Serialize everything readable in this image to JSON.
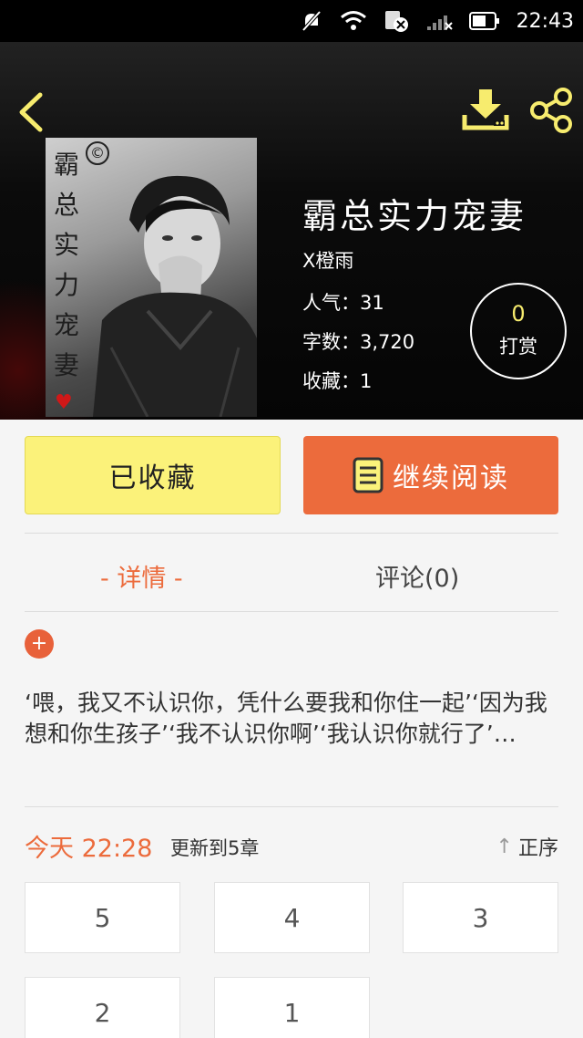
{
  "status_bar": {
    "time": "22:43",
    "icons": [
      "mute-icon",
      "wifi-icon",
      "notification-icon",
      "signal-icon",
      "battery-icon"
    ]
  },
  "header": {
    "back_icon": "chevron-left-icon",
    "download_icon": "download-icon",
    "share_icon": "share-icon",
    "cover": {
      "vertical_title": [
        "霸",
        "总",
        "实",
        "力",
        "宠",
        "妻"
      ]
    },
    "book": {
      "title": "霸总实力宠妻",
      "author": "X橙雨",
      "popularity": "人气：31",
      "word_count": "字数：3,720",
      "favorites": "收藏：1"
    },
    "tip": {
      "count": "0",
      "label": "打赏"
    }
  },
  "actions": {
    "favorite_label": "已收藏",
    "read_label": "继续阅读"
  },
  "tabs": {
    "details": "- 详情 -",
    "comments": "评论(0)"
  },
  "synopsis": {
    "expand_symbol": "+",
    "text": "‘喂，我又不认识你，凭什么要我和你住一起’‘因为我想和你生孩子’‘我不认识你啊’‘我认识你就行了’…"
  },
  "update": {
    "time": "今天 22:28",
    "text": "更新到5章",
    "sort_label": "正序"
  },
  "chapters": [
    "5",
    "4",
    "3",
    "2",
    "1"
  ],
  "colors": {
    "accent": "#ec6b3c",
    "favorite_bg": "#fbf27a",
    "header_bg": "#0b0b0b",
    "tip_count": "#f7ec6e"
  }
}
